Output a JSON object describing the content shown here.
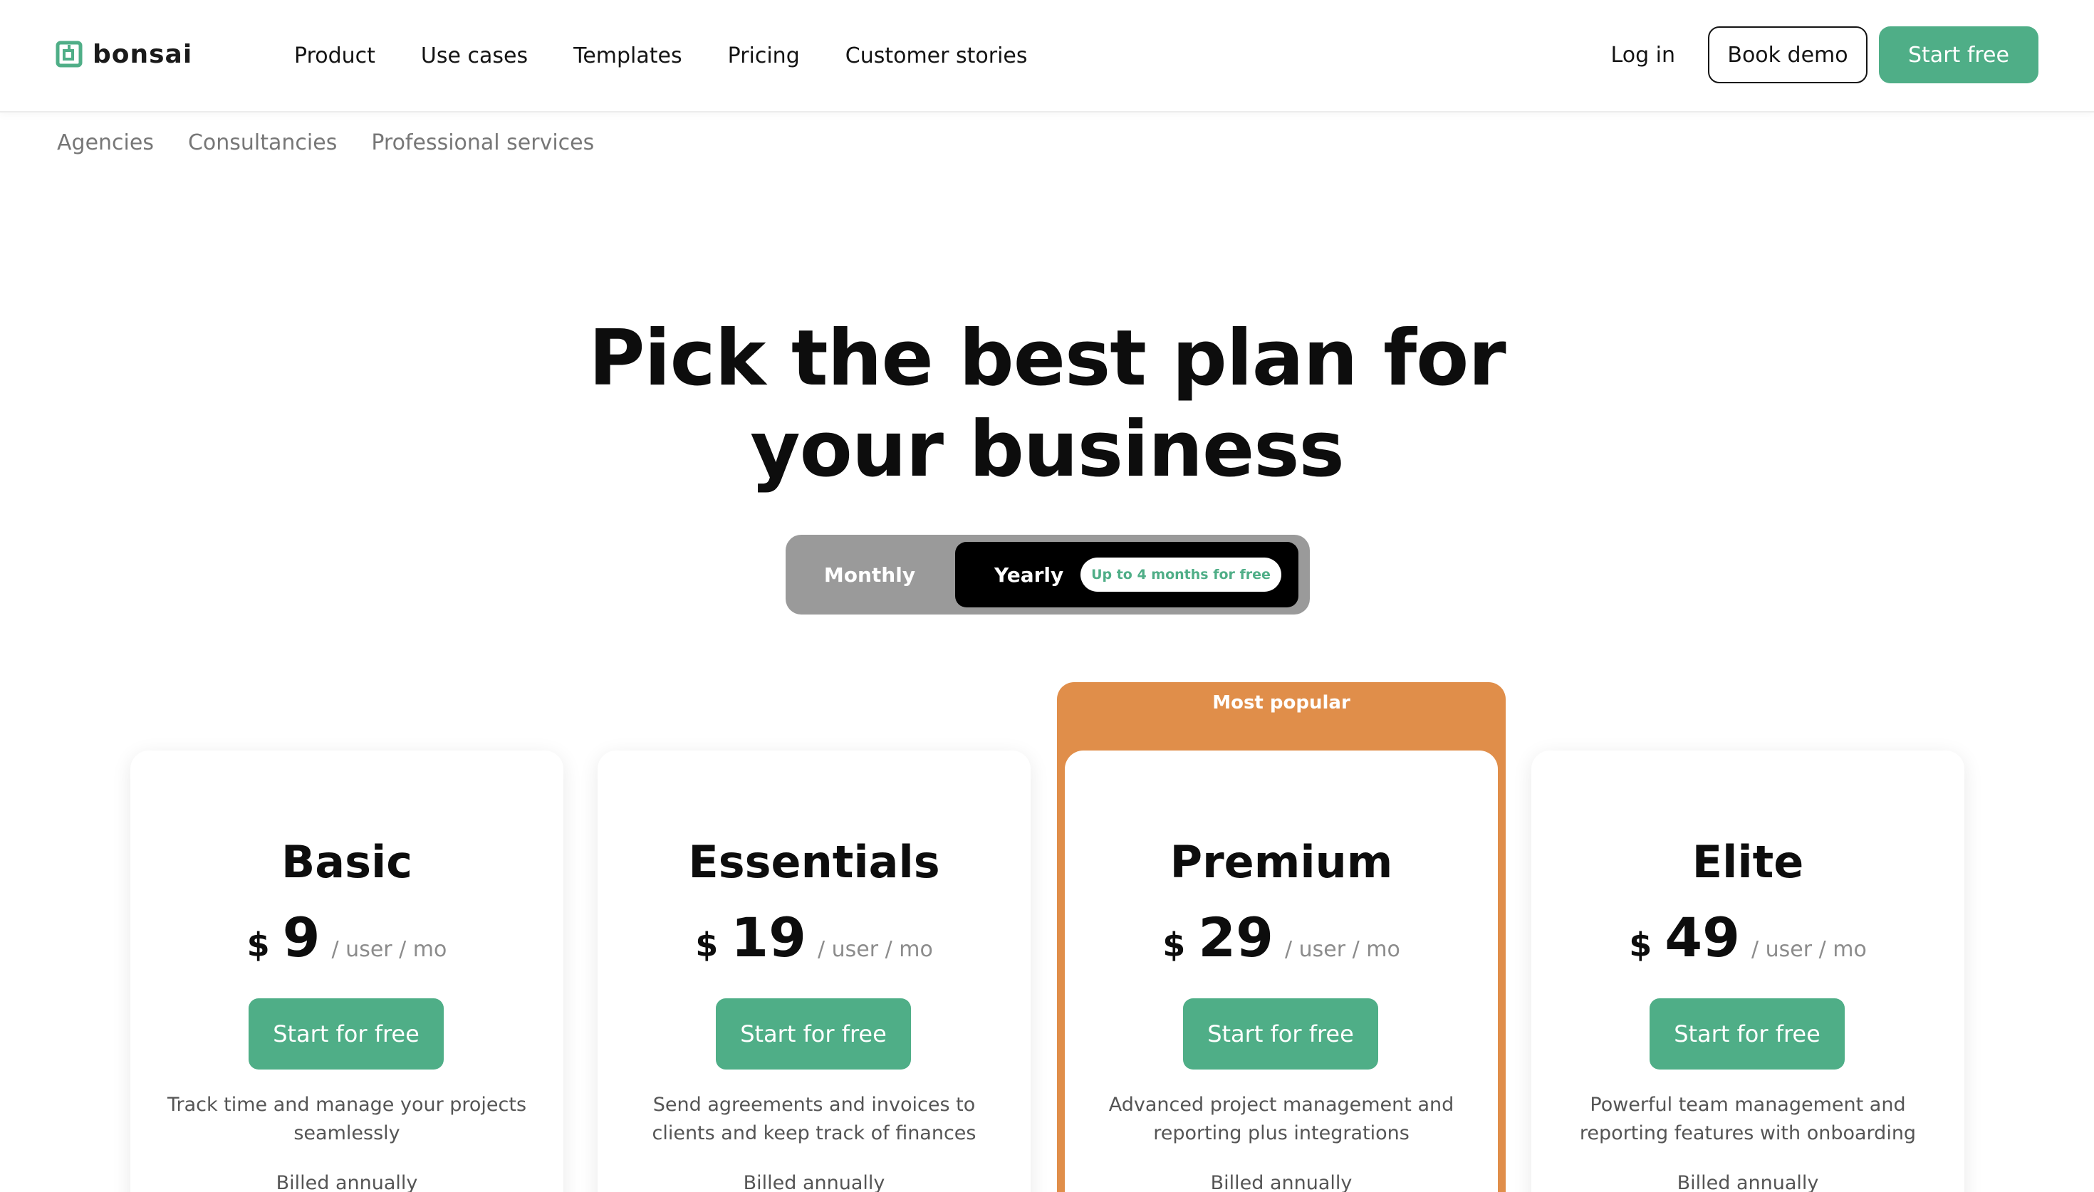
{
  "header": {
    "logo_text": "bonsai",
    "nav": [
      "Product",
      "Use cases",
      "Templates",
      "Pricing",
      "Customer stories"
    ],
    "login_label": "Log in",
    "demo_label": "Book demo",
    "start_label": "Start free"
  },
  "subnav": [
    "Agencies",
    "Consultancies",
    "Professional services"
  ],
  "hero": {
    "title_line1": "Pick the best plan for",
    "title_line2": "your business"
  },
  "billing_toggle": {
    "monthly_label": "Monthly",
    "yearly_label": "Yearly",
    "badge": "Up to 4 months for free",
    "selected": "Yearly"
  },
  "popular_label": "Most popular",
  "plans": [
    {
      "name": "Basic",
      "currency": "$",
      "price": "9",
      "unit": "/ user / mo",
      "cta": "Start for free",
      "description": "Track time and manage your projects seamlessly",
      "billing": "Billed annually"
    },
    {
      "name": "Essentials",
      "currency": "$",
      "price": "19",
      "unit": "/ user / mo",
      "cta": "Start for free",
      "description": "Send agreements and invoices to clients and keep track of finances",
      "billing": "Billed annually"
    },
    {
      "name": "Premium",
      "currency": "$",
      "price": "29",
      "unit": "/ user / mo",
      "cta": "Start for free",
      "description": "Advanced project management and reporting plus integrations",
      "billing": "Billed annually"
    },
    {
      "name": "Elite",
      "currency": "$",
      "price": "49",
      "unit": "/ user / mo",
      "cta": "Start for free",
      "description": "Powerful team management and reporting features with onboarding",
      "billing": "Billed annually"
    }
  ],
  "colors": {
    "brand_green": "#4fae87",
    "popular_orange": "#e08e4a",
    "toggle_gray": "#9a9a9a"
  }
}
